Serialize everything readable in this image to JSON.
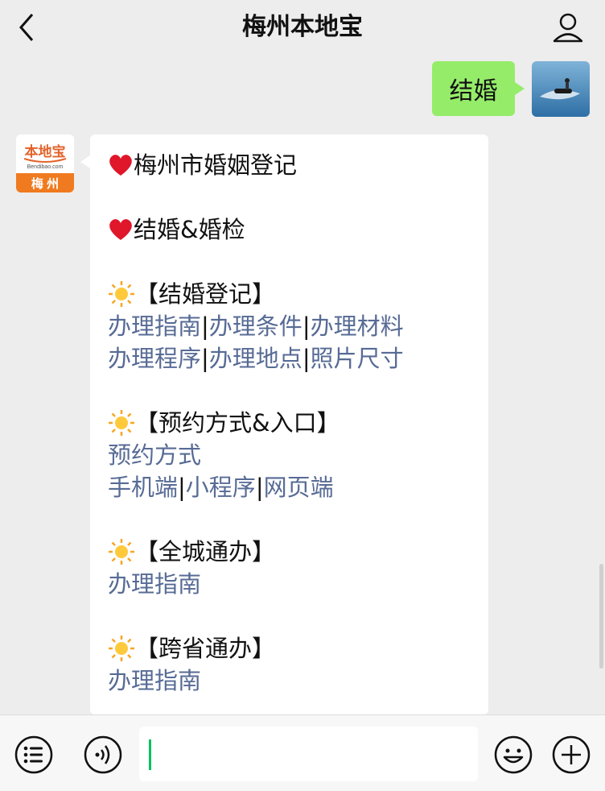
{
  "header": {
    "title": "梅州本地宝"
  },
  "conversation": {
    "sent_message": "结婚",
    "bot_logo": {
      "brand": "本地宝",
      "domain": "Bendibao.com",
      "city": "梅 州"
    },
    "reply": {
      "heading1": "梅州市婚姻登记",
      "heading2": "结婚&婚检",
      "sections": [
        {
          "title": "【结婚登记】",
          "rows": [
            [
              "办理指南",
              "办理条件",
              "办理材料"
            ],
            [
              "办理程序",
              "办理地点",
              "照片尺寸"
            ]
          ]
        },
        {
          "title": "【预约方式&入口】",
          "rows": [
            [
              "预约方式"
            ],
            [
              "手机端",
              "小程序",
              "网页端"
            ]
          ]
        },
        {
          "title": "【全城通办】",
          "rows": [
            [
              "办理指南"
            ]
          ]
        },
        {
          "title": "【跨省通办】",
          "rows": [
            [
              "办理指南"
            ]
          ]
        }
      ],
      "separator": "|"
    }
  },
  "input_bar": {
    "icons": [
      "menu-icon",
      "voice-icon",
      "emoji-icon",
      "plus-icon"
    ],
    "text_value": ""
  },
  "colors": {
    "background": "#ededed",
    "sent_bubble": "#95ec69",
    "link": "#576b95",
    "logo_orange": "#f07a1f",
    "caret": "#07c160"
  }
}
